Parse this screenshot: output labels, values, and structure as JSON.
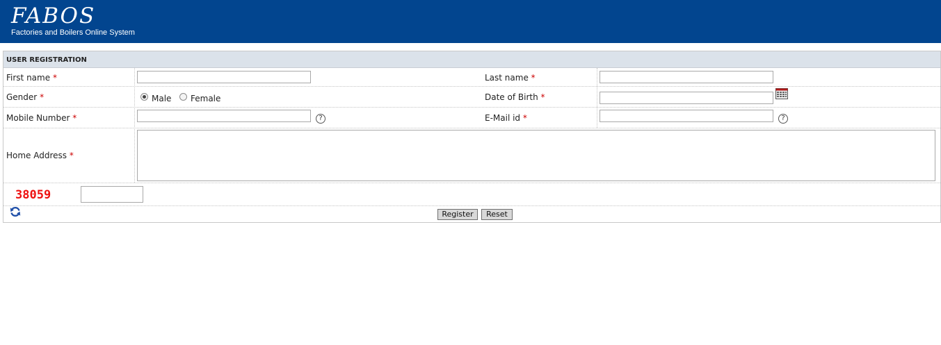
{
  "header": {
    "logo": "FABOS",
    "subtitle": "Factories and Boilers Online System"
  },
  "form": {
    "title": "USER REGISTRATION",
    "required_mark": "*",
    "first_name": {
      "label": "First name",
      "value": ""
    },
    "last_name": {
      "label": "Last name",
      "value": ""
    },
    "gender": {
      "label": "Gender",
      "options": [
        "Male",
        "Female"
      ],
      "selected": "Male"
    },
    "dob": {
      "label": "Date of Birth",
      "value": ""
    },
    "mobile": {
      "label": "Mobile Number",
      "value": ""
    },
    "email": {
      "label": "E-Mail id",
      "value": ""
    },
    "address": {
      "label": "Home Address",
      "value": ""
    },
    "captcha": {
      "code": "38059",
      "value": ""
    },
    "help_symbol": "?",
    "buttons": {
      "register": "Register",
      "reset": "Reset"
    }
  }
}
